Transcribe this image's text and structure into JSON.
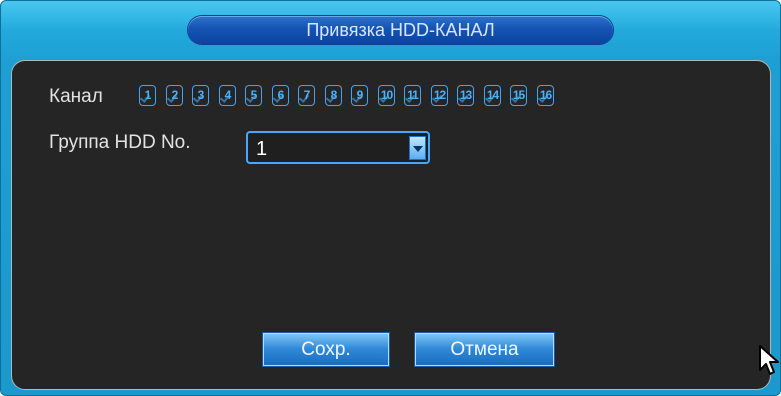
{
  "dialog": {
    "title": "Привязка HDD-КАНАЛ"
  },
  "form": {
    "channel_label": "Канал",
    "channels": [
      "1",
      "2",
      "3",
      "4",
      "5",
      "6",
      "7",
      "8",
      "9",
      "10",
      "11",
      "12",
      "13",
      "14",
      "15",
      "16"
    ],
    "hdd_group_label": "Группа HDD No.",
    "hdd_group_value": "1"
  },
  "buttons": {
    "save": "Сохр.",
    "cancel": "Отмена"
  },
  "colors": {
    "frame": "#1e9fd4",
    "panel": "#252525",
    "accent": "#44a3f6"
  },
  "icons": {
    "dropdown": "chevron-down-icon",
    "pointer": "mouse-pointer-icon"
  }
}
